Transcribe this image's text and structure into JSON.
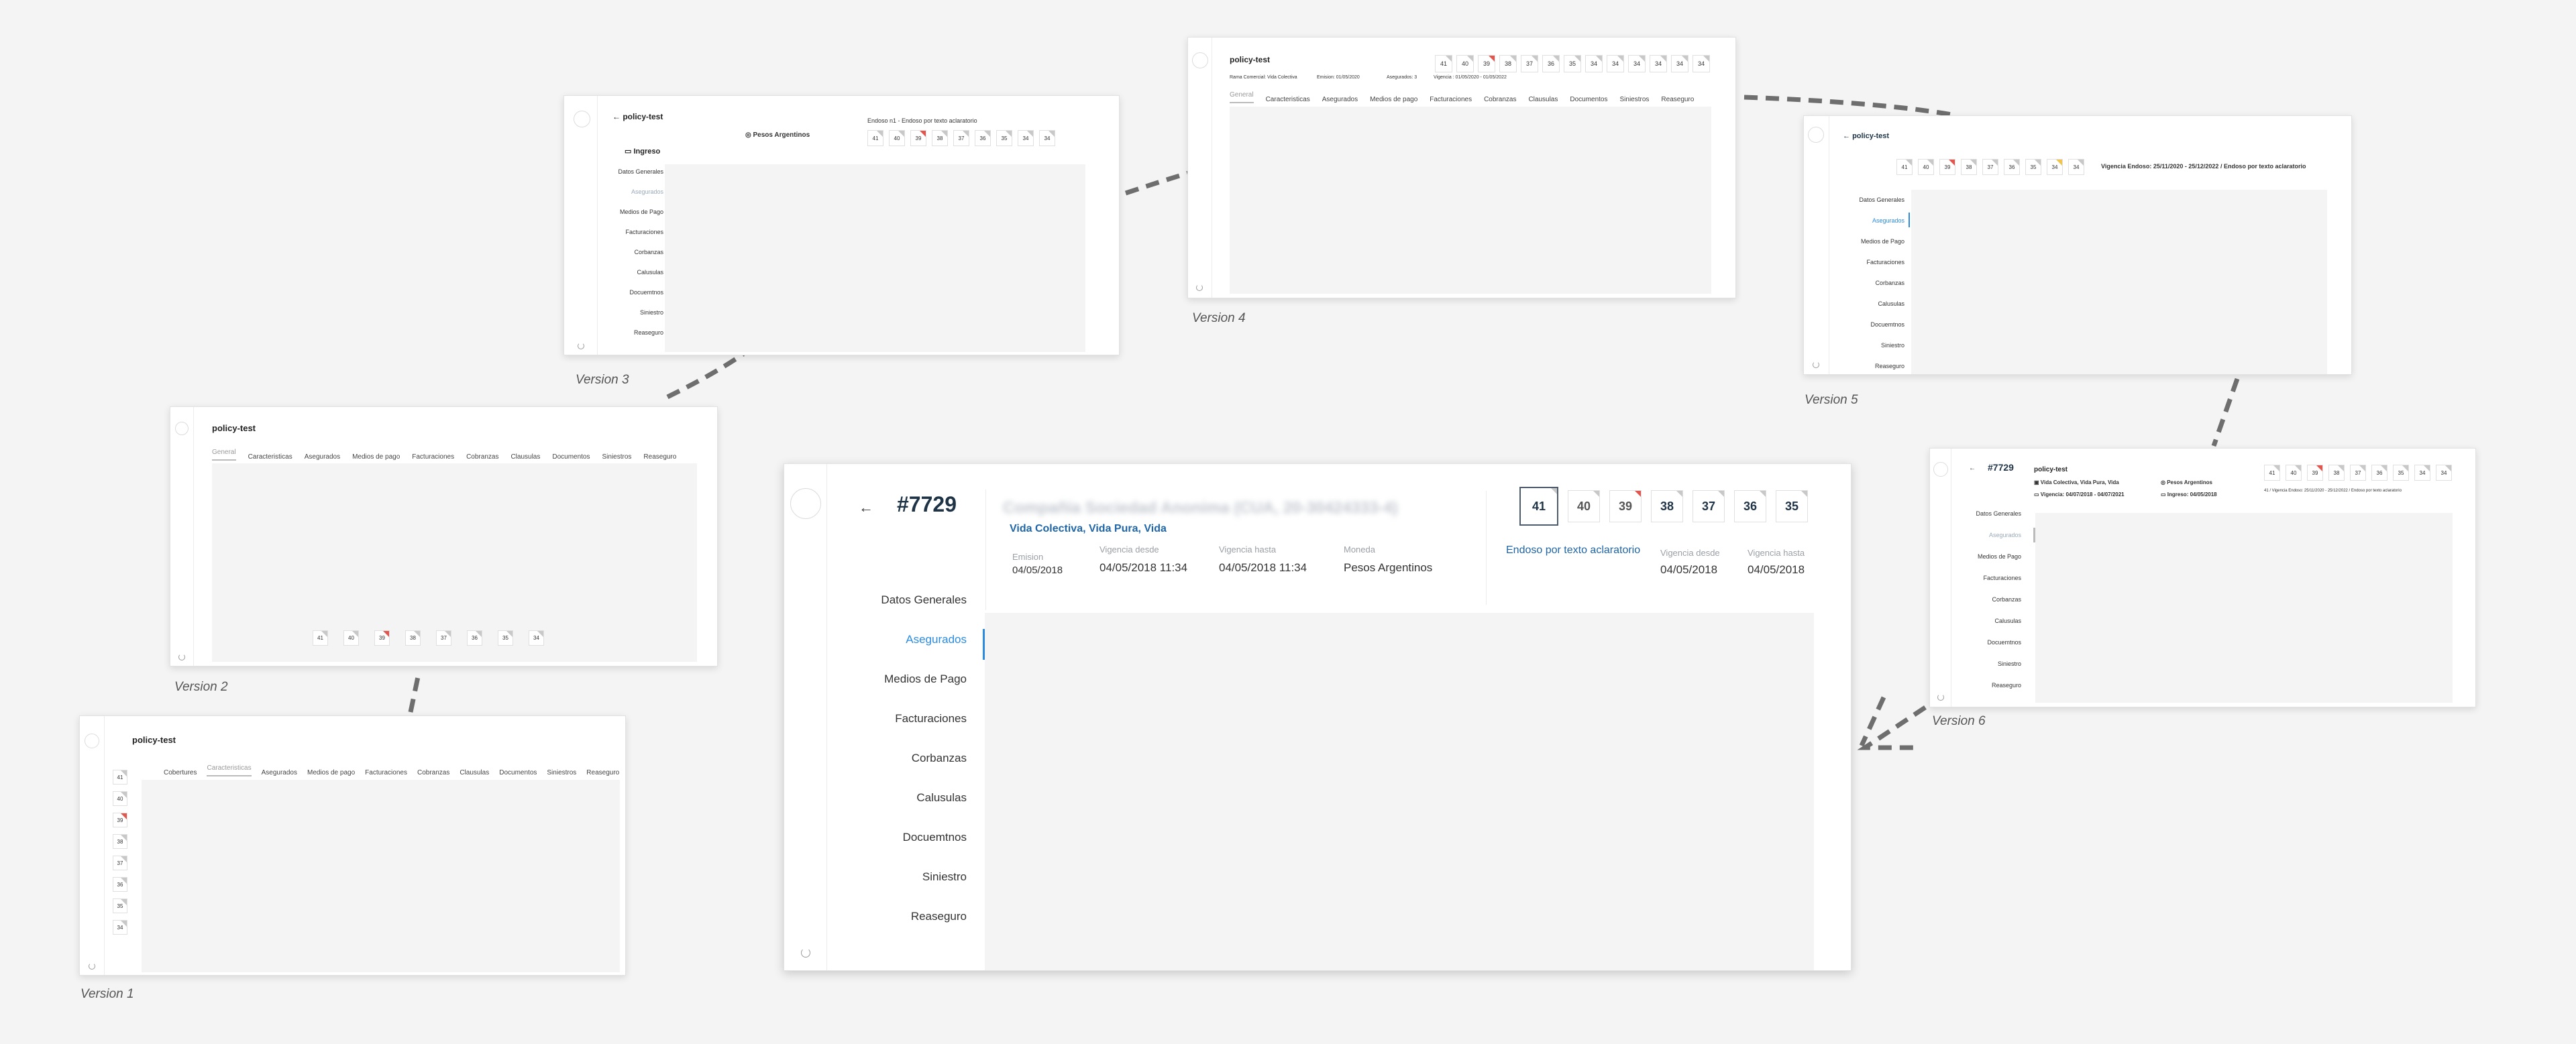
{
  "v1": {
    "label": "Version 1",
    "title": "policy-test",
    "tabs": [
      "Cobertures",
      "Caracteristicas",
      "Asegurados",
      "Medios de pago",
      "Facturaciones",
      "Cobranzas",
      "Clausulas",
      "Documentos",
      "Siniestros",
      "Reaseguro"
    ],
    "endorsements": [
      "41",
      "40",
      "39",
      "38",
      "37",
      "36",
      "35",
      "34"
    ]
  },
  "v2": {
    "label": "Version 2",
    "title": "policy-test",
    "tabs": [
      "General",
      "Caracteristicas",
      "Asegurados",
      "Medios de pago",
      "Facturaciones",
      "Cobranzas",
      "Clausulas",
      "Documentos",
      "Siniestros",
      "Reaseguro"
    ],
    "endorsements": [
      "41",
      "40",
      "39",
      "38",
      "37",
      "36",
      "35",
      "34"
    ]
  },
  "v3": {
    "label": "Version 3",
    "title": "policy-test",
    "section": "Ingreso",
    "currency": "Pesos Argentinos",
    "endoso_text": "Endoso n1 - Endoso por texto aclaratorio",
    "nav": [
      "Datos Generales",
      "Asegurados",
      "Medios de Pago",
      "Facturaciones",
      "Corbanzas",
      "Calusulas",
      "Docuemtnos",
      "Siniestro",
      "Reaseguro"
    ],
    "endorsements": [
      "41",
      "40",
      "39",
      "38",
      "37",
      "36",
      "35",
      "34",
      "34"
    ]
  },
  "v4": {
    "label": "Version 4",
    "title": "policy-test",
    "meta": [
      "Rama Comercial: Vida Colectiva",
      "Emision: 01/05/2020",
      "Asegurados: 3",
      "Vigencia : 01/05/2020 - 01/05/2022"
    ],
    "tabs": [
      "General",
      "Caracteristicas",
      "Asegurados",
      "Medios de pago",
      "Facturaciones",
      "Cobranzas",
      "Clausulas",
      "Documentos",
      "Siniestros",
      "Reaseguro"
    ],
    "endorsements": [
      "41",
      "40",
      "39",
      "38",
      "37",
      "36",
      "35",
      "34",
      "34",
      "34",
      "34",
      "34",
      "34"
    ]
  },
  "v5": {
    "label": "Version 5",
    "title": "policy-test",
    "vigencia_text": "Vigencia Endoso: 25/11/2020 - 25/12/2022   / Endoso por texto aclaratorio",
    "nav": [
      "Datos Generales",
      "Asegurados",
      "Medios de Pago",
      "Facturaciones",
      "Corbanzas",
      "Calusulas",
      "Docuemtnos",
      "Siniestro",
      "Reaseguro"
    ],
    "endorsements": [
      "41",
      "40",
      "39",
      "38",
      "37",
      "36",
      "35",
      "34",
      "34"
    ]
  },
  "v6": {
    "label": "Version 6",
    "number": "#7729",
    "title": "policy-test",
    "product": "Vida Colectiva, Vida Pura, Vida",
    "currency": "Pesos Argentinos",
    "vigencia": "Vigencia: 04/07/2018 - 04/07/2021",
    "ingreso": "Ingreso: 04/05/2018",
    "endoso_text": "41 / Vigencia Endoso: 25/11/2020 - 25/12/2022 / Endoso por texto aclaratorio",
    "nav": [
      "Datos Generales",
      "Asegurados",
      "Medios de Pago",
      "Facturaciones",
      "Corbanzas",
      "Calusulas",
      "Docuemtnos",
      "Siniestro",
      "Reaseguro"
    ],
    "endorsements": [
      "41",
      "40",
      "39",
      "38",
      "37",
      "36",
      "35",
      "34",
      "34"
    ]
  },
  "main": {
    "back": "←",
    "number": "#7729",
    "company_blurred": "Compañía Sociedad Anonima (CUA, 20-30424333-4)",
    "product": "Vida Colectiva, Vida Pura, Vida",
    "fields": [
      {
        "label": "Emision",
        "value": "04/05/2018"
      },
      {
        "label": "Vigencia desde",
        "value": "04/05/2018 11:34"
      },
      {
        "label": "Vigencia hasta",
        "value": "04/05/2018 11:34"
      },
      {
        "label": "Moneda",
        "value": "Pesos Argentinos"
      }
    ],
    "endoso_link": "Endoso por texto aclaratorio",
    "right_fields": [
      {
        "label": "Vigencia desde",
        "value": "04/05/2018"
      },
      {
        "label": "Vigencia hasta",
        "value": "04/05/2018"
      }
    ],
    "nav": [
      "Datos Generales",
      "Asegurados",
      "Medios de Pago",
      "Facturaciones",
      "Corbanzas",
      "Calusulas",
      "Docuemtnos",
      "Siniestro",
      "Reaseguro"
    ],
    "endorsements": [
      "41",
      "40",
      "39",
      "38",
      "37",
      "36",
      "35"
    ],
    "accent": "#2a8be0",
    "dark": "#1f3347"
  }
}
